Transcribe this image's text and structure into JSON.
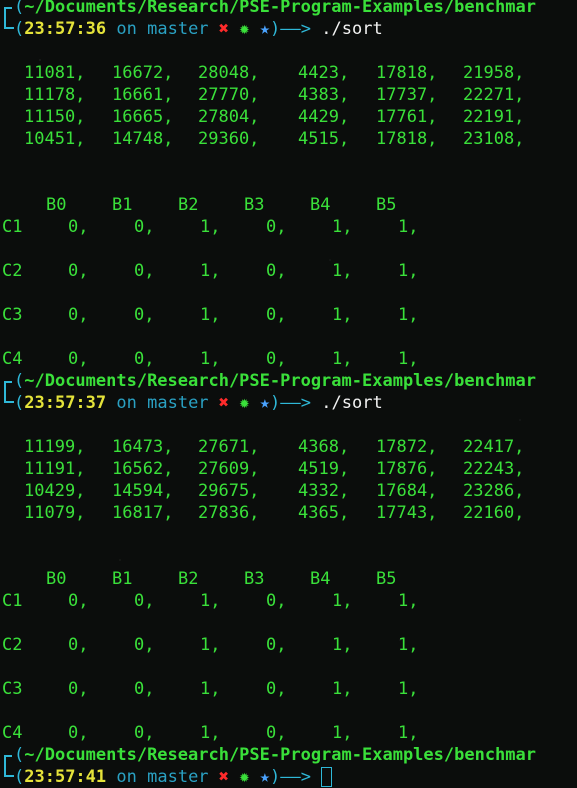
{
  "prompts": [
    {
      "cwd": "~/Documents/Research/PSE-Program-Examples/benchmar",
      "time": "23:57:36",
      "on": "on",
      "branch": "master",
      "command": "./sort"
    },
    {
      "cwd": "~/Documents/Research/PSE-Program-Examples/benchmar",
      "time": "23:57:37",
      "on": "on",
      "branch": "master",
      "command": "./sort"
    },
    {
      "cwd": "~/Documents/Research/PSE-Program-Examples/benchmar",
      "time": "23:57:41",
      "on": "on",
      "branch": "master",
      "command": ""
    }
  ],
  "prompt_symbols": {
    "open": "(",
    "close": ")",
    "arrow": "——>",
    "dirty": "✖",
    "gear": "✹",
    "star": "★",
    "corner_top": "┌",
    "corner_bot": "└"
  },
  "runs": [
    {
      "timings": [
        [
          "11081,",
          "16672,",
          "28048,",
          "4423,",
          "17818,",
          "21958,"
        ],
        [
          "11178,",
          "16661,",
          "27770,",
          "4383,",
          "17737,",
          "22271,"
        ],
        [
          "11150,",
          "16665,",
          "27804,",
          "4429,",
          "17761,",
          "22191,"
        ],
        [
          "10451,",
          "14748,",
          "29360,",
          "4515,",
          "17818,",
          "23108,"
        ]
      ],
      "headers": [
        "B0",
        "B1",
        "B2",
        "B3",
        "B4",
        "B5"
      ],
      "rows": [
        {
          "label": "C1",
          "values": [
            "0,",
            "0,",
            "1,",
            "0,",
            "1,",
            "1,"
          ]
        },
        {
          "label": "C2",
          "values": [
            "0,",
            "0,",
            "1,",
            "0,",
            "1,",
            "1,"
          ]
        },
        {
          "label": "C3",
          "values": [
            "0,",
            "0,",
            "1,",
            "0,",
            "1,",
            "1,"
          ]
        },
        {
          "label": "C4",
          "values": [
            "0,",
            "0,",
            "1,",
            "0,",
            "1,",
            "1,"
          ]
        }
      ]
    },
    {
      "timings": [
        [
          "11199,",
          "16473,",
          "27671,",
          "4368,",
          "17872,",
          "22417,"
        ],
        [
          "11191,",
          "16562,",
          "27609,",
          "4519,",
          "17876,",
          "22243,"
        ],
        [
          "10429,",
          "14594,",
          "29675,",
          "4332,",
          "17684,",
          "23286,"
        ],
        [
          "11079,",
          "16817,",
          "27836,",
          "4365,",
          "17743,",
          "22160,"
        ]
      ],
      "headers": [
        "B0",
        "B1",
        "B2",
        "B3",
        "B4",
        "B5"
      ],
      "rows": [
        {
          "label": "C1",
          "values": [
            "0,",
            "0,",
            "1,",
            "0,",
            "1,",
            "1,"
          ]
        },
        {
          "label": "C2",
          "values": [
            "0,",
            "0,",
            "1,",
            "0,",
            "1,",
            "1,"
          ]
        },
        {
          "label": "C3",
          "values": [
            "0,",
            "0,",
            "1,",
            "0,",
            "1,",
            "1,"
          ]
        },
        {
          "label": "C4",
          "values": [
            "0,",
            "0,",
            "1,",
            "0,",
            "1,",
            "1,"
          ]
        }
      ]
    }
  ]
}
